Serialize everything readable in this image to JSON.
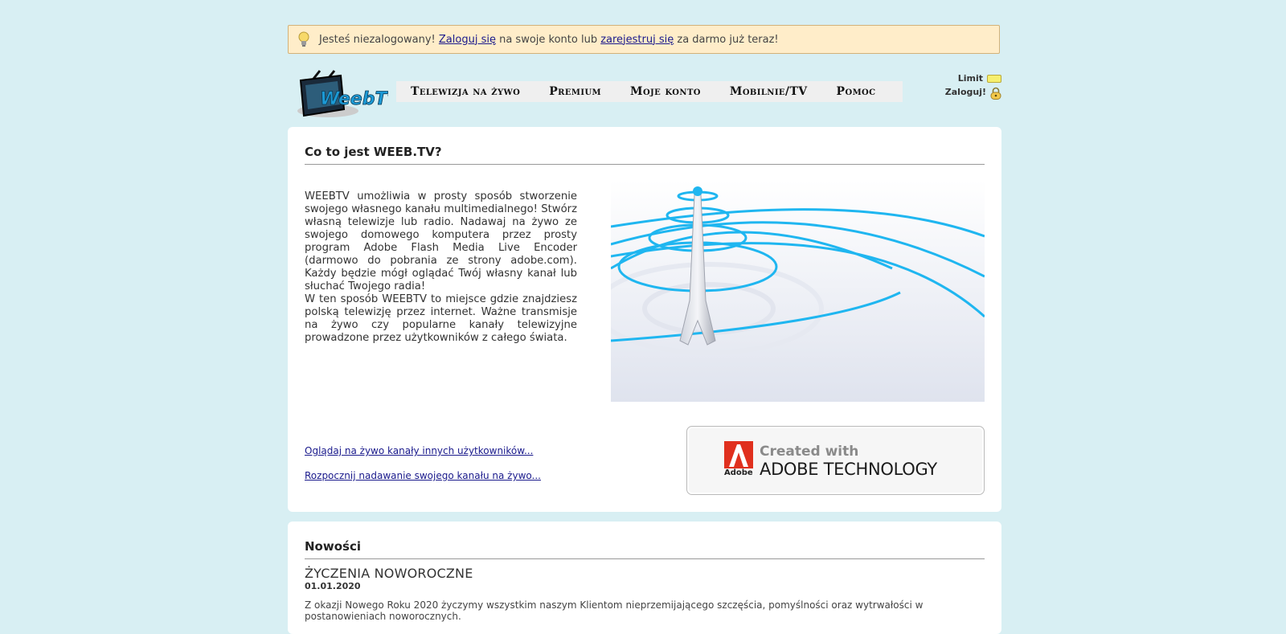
{
  "notice": {
    "prefix": "Jesteś niezalogowany! ",
    "login_link": "Zaloguj się",
    "middle": " na swoje konto lub ",
    "register_link": "zarejestruj się",
    "suffix": " za darmo już teraz!"
  },
  "logo": {
    "text": "WeebTv"
  },
  "nav": {
    "items": [
      {
        "label": "Telewizja na żywo"
      },
      {
        "label": "Premium"
      },
      {
        "label": "Moje konto"
      },
      {
        "label": "Mobilnie/TV"
      },
      {
        "label": "Pomoc"
      }
    ]
  },
  "userbox": {
    "limit_label": "Limit",
    "login_label": "Zaloguj!"
  },
  "about": {
    "title": "Co to jest WEEB.TV?",
    "paragraph1": "WEEBTV umożliwia w prosty sposób stworzenie swojego własnego kanału multimedialnego! Stwórz własną telewizje lub radio. Nadawaj na żywo ze swojego domowego komputera przez prosty program Adobe Flash Media Live Encoder (darmowo do pobrania ze strony adobe.com). Każdy będzie mógł oglądać Twój własny kanał lub słuchać Twojego radia!",
    "paragraph2": "W ten sposób WEEBTV to miejsce gdzie znajdziesz polską telewizję przez internet. Ważne transmisje na żywo czy popularne kanały telewizyjne prowadzone przez użytkowników z całego świata.",
    "link_watch": "Oglądaj na żywo kanały innych użytkowników...",
    "link_broadcast": "Rozpocznij nadawanie swojego kanału na żywo...",
    "badge": {
      "created": "Created with",
      "technology": "ADOBE TECHNOLOGY",
      "brand": "Adobe"
    }
  },
  "news": {
    "title": "Nowości",
    "item": {
      "headline": "ŻYCZENIA NOWOROCZNE",
      "date": "01.01.2020",
      "body": "Z okazji Nowego Roku 2020 życzymy wszystkim naszym Klientom nieprzemijającego szczęścia, pomyślności oraz wytrwałości w postanowieniach noworocznych."
    }
  },
  "colors": {
    "background": "#d8eff3",
    "notice": "#ffedc9",
    "link": "#1a1a8c",
    "ring": "#1fb6f0"
  }
}
